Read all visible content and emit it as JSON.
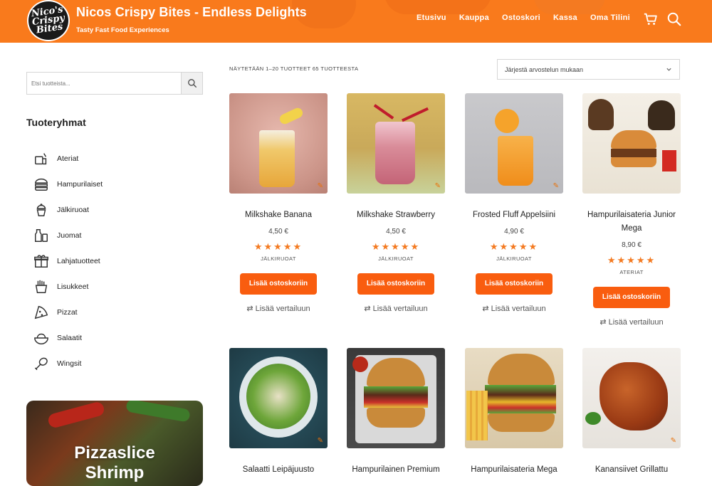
{
  "header": {
    "logo_text": "Nico's Crispy Bites",
    "title": "Nicos Crispy Bites - Endless Delights",
    "tagline": "Tasty Fast Food Experiences",
    "nav": [
      "Etusivu",
      "Kauppa",
      "Ostoskori",
      "Kassa",
      "Oma Tilini"
    ],
    "bg_color": "#f97a1c"
  },
  "sidebar": {
    "search_placeholder": "Etsi tuotteista...",
    "categories_title": "Tuoteryhmat",
    "categories": [
      {
        "label": "Ateriat",
        "icon": "meal-icon"
      },
      {
        "label": "Hampurilaiset",
        "icon": "burger-icon"
      },
      {
        "label": "Jälkiruoat",
        "icon": "dessert-icon"
      },
      {
        "label": "Juomat",
        "icon": "drinks-icon"
      },
      {
        "label": "Lahjatuotteet",
        "icon": "gift-icon"
      },
      {
        "label": "Lisukkeet",
        "icon": "fries-icon"
      },
      {
        "label": "Pizzat",
        "icon": "pizza-icon"
      },
      {
        "label": "Salaatit",
        "icon": "salad-icon"
      },
      {
        "label": "Wingsit",
        "icon": "wing-icon"
      }
    ],
    "promo_title": "Pizzaslice",
    "promo_sub": "Shrimp"
  },
  "shop": {
    "result_count": "NÄYTETÄÄN 1–20 TUOTTEET 65 TUOTTEESTA",
    "sort_selected": "Järjestä arvostelun mukaan",
    "add_to_cart": "Lisää ostoskoriin",
    "compare": "Lisää vertailuun",
    "products": [
      {
        "name": "Milkshake Banana",
        "price": "4,50 €",
        "category": "JÄLKIRUOAT",
        "rating": 5
      },
      {
        "name": "Milkshake Strawberry",
        "price": "4,50 €",
        "category": "JÄLKIRUOAT",
        "rating": 5
      },
      {
        "name": "Frosted Fluff Appelsiini",
        "price": "4,90 €",
        "category": "JÄLKIRUOAT",
        "rating": 5
      },
      {
        "name": "Hampurilaisateria Junior Mega",
        "price": "8,90 €",
        "category": "ATERIAT",
        "rating": 5
      },
      {
        "name": "Salaatti Leipäjuusto"
      },
      {
        "name": "Hampurilainen Premium"
      },
      {
        "name": "Hampurilaisateria Mega"
      },
      {
        "name": "Kanansiivet Grillattu"
      }
    ],
    "accent_color": "#f95d0f",
    "star_color": "#f47a21"
  }
}
